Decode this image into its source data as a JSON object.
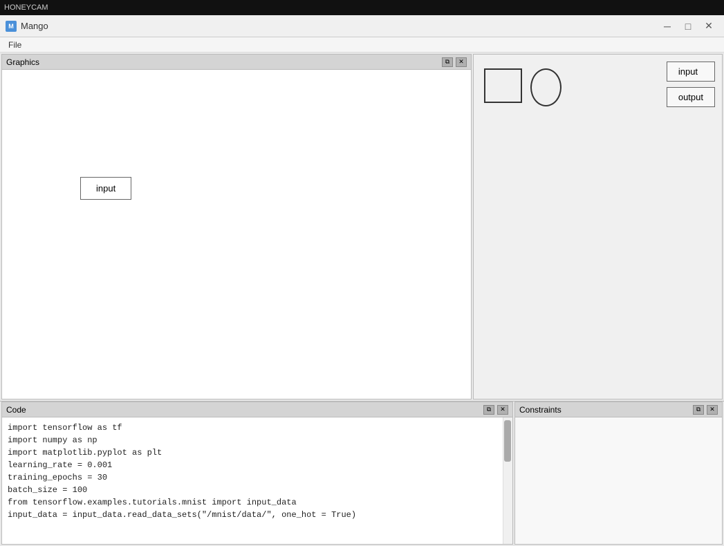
{
  "topbar": {
    "label": "HONEYCAM"
  },
  "titlebar": {
    "icon_label": "M",
    "title": "Mango",
    "minimize_label": "─",
    "maximize_label": "□",
    "close_label": "✕"
  },
  "menu": {
    "items": [
      "File"
    ]
  },
  "graphics_panel": {
    "title": "Graphics",
    "restore_btn": "🗗",
    "close_btn": "✕"
  },
  "input_node_graphics": {
    "label": "input"
  },
  "right_panel": {
    "input_btn": "input",
    "output_btn": "output"
  },
  "code_panel": {
    "title": "Code",
    "restore_btn": "🗗",
    "close_btn": "✕",
    "lines": [
      "import tensorflow as tf",
      "import numpy as np",
      "import matplotlib.pyplot as plt",
      "",
      "learning_rate = 0.001",
      "training_epochs = 30",
      "batch_size = 100",
      "from tensorflow.examples.tutorials.mnist import input_data",
      "",
      "input_data = input_data.read_data_sets(\"/mnist/data/\", one_hot = True)"
    ]
  },
  "constraints_panel": {
    "title": "Constraints",
    "restore_btn": "🗗",
    "close_btn": "✕"
  }
}
